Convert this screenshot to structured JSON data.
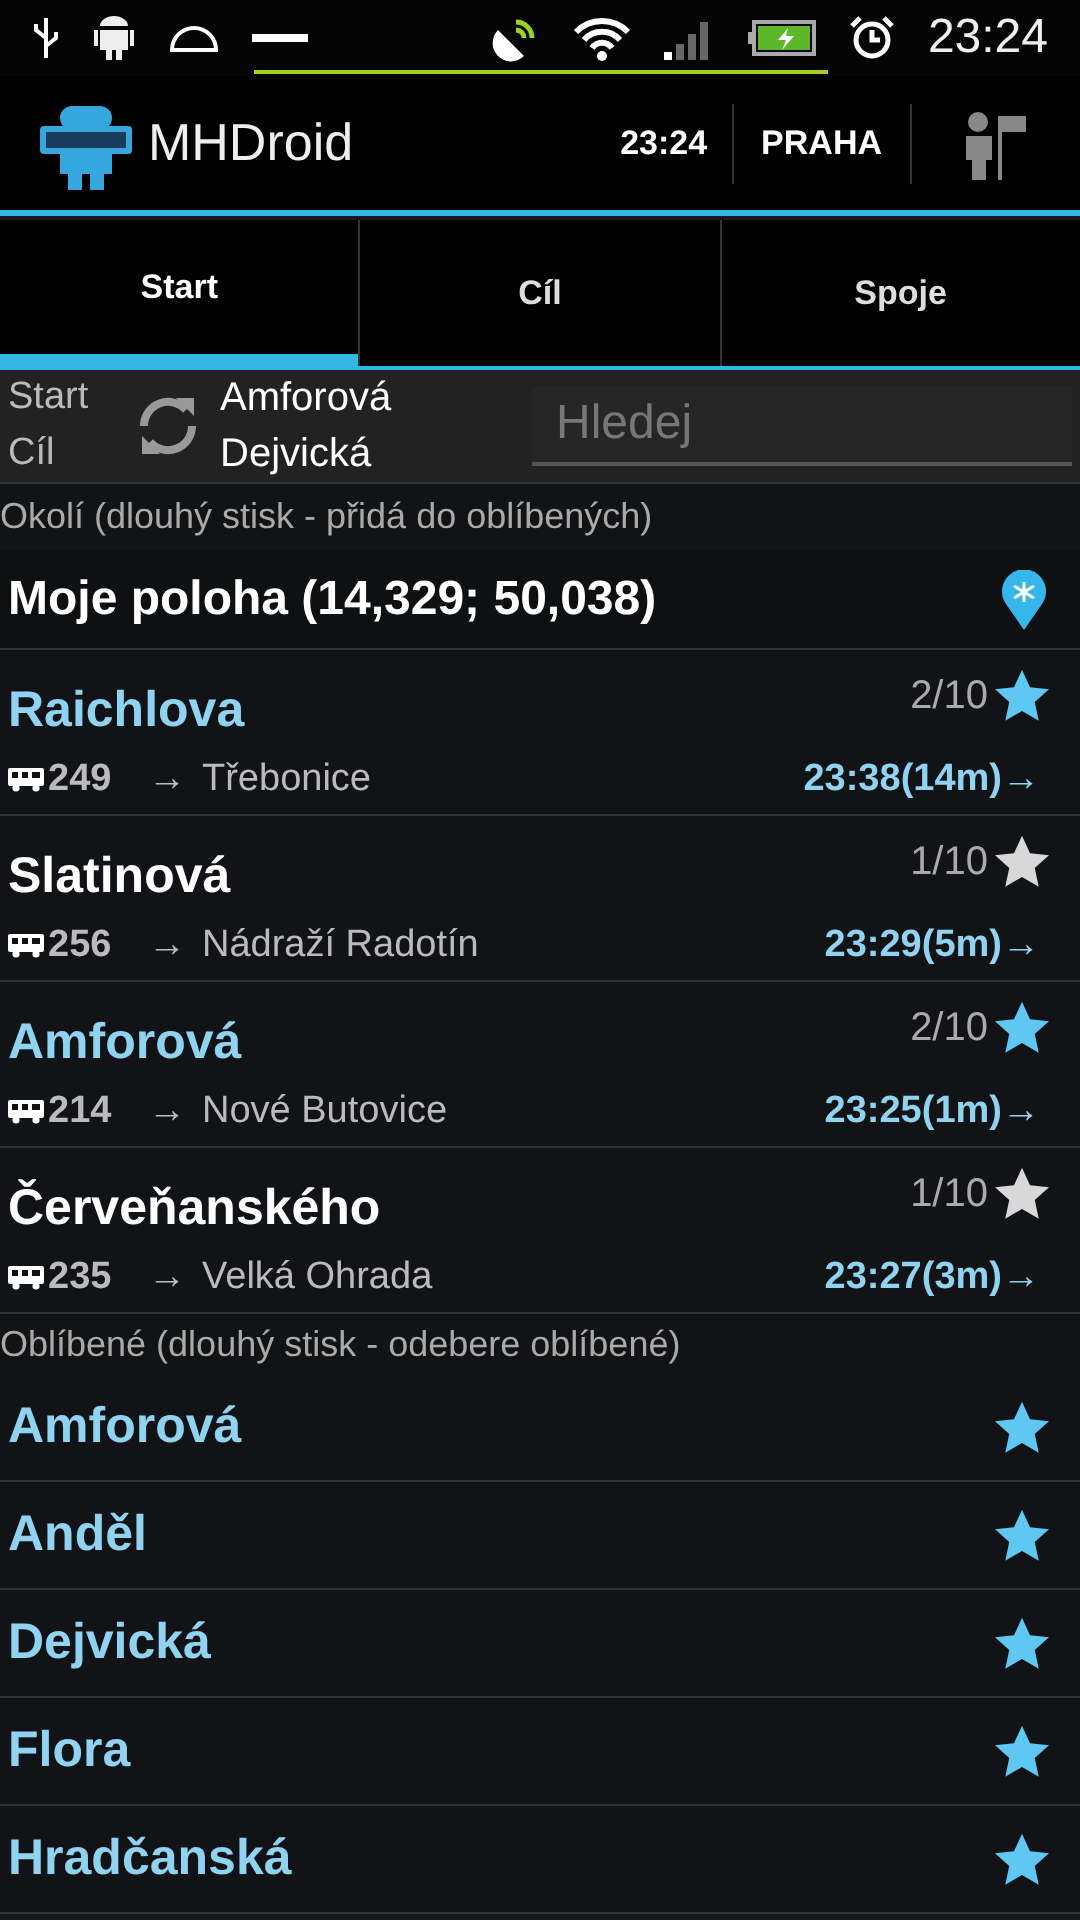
{
  "status_bar": {
    "time": "23:24"
  },
  "action_bar": {
    "title": "MHDroid",
    "time": "23:24",
    "city": "PRAHA"
  },
  "tabs": [
    {
      "label": "Start",
      "selected": true
    },
    {
      "label": "Cíl",
      "selected": false
    },
    {
      "label": "Spoje",
      "selected": false
    }
  ],
  "route": {
    "start_label": "Start",
    "end_label": "Cíl",
    "start": "Amforová",
    "end": "Dejvická",
    "search": {
      "placeholder": "Hledej"
    }
  },
  "nearby": {
    "header": "Okolí (dlouhý stisk - přidá do oblíbených)",
    "location": "Moje poloha (14,329; 50,038)",
    "stops": [
      {
        "name": "Raichlova",
        "count": "2/10",
        "favorite": true,
        "line": "249",
        "arrow": "→",
        "destination": "Třebonice",
        "departure": "23:38(14m)→"
      },
      {
        "name": "Slatinová",
        "count": "1/10",
        "favorite": false,
        "line": "256",
        "arrow": "→",
        "destination": "Nádraží Radotín",
        "departure": "23:29(5m)→"
      },
      {
        "name": "Amforová",
        "count": "2/10",
        "favorite": true,
        "line": "214",
        "arrow": "→",
        "destination": "Nové Butovice",
        "departure": "23:25(1m)→"
      },
      {
        "name": "Červeňanského",
        "count": "1/10",
        "favorite": false,
        "line": "235",
        "arrow": "→",
        "destination": "Velká Ohrada",
        "departure": "23:27(3m)→"
      }
    ]
  },
  "favorites": {
    "header": "Oblíbené (dlouhý stisk - odebere oblíbené)",
    "stops": [
      {
        "name": "Amforová",
        "favorite": true
      },
      {
        "name": "Anděl",
        "favorite": true
      },
      {
        "name": "Dejvická",
        "favorite": true
      },
      {
        "name": "Flora",
        "favorite": true
      },
      {
        "name": "Hradčanská",
        "favorite": true
      }
    ]
  }
}
